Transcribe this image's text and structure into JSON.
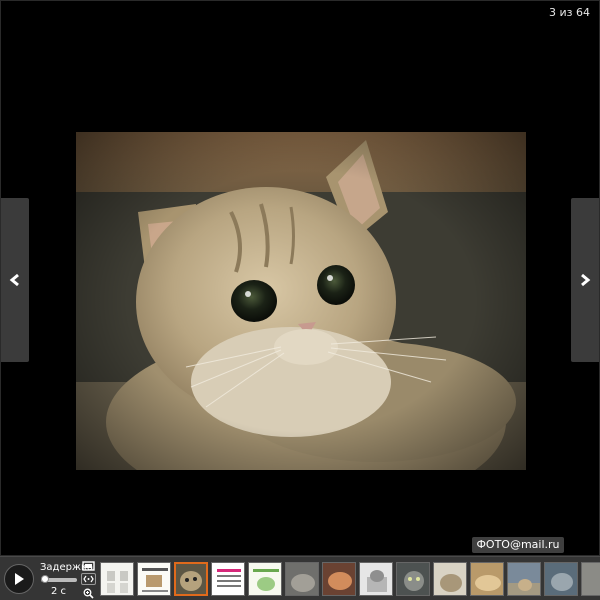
{
  "counter": {
    "text": "3 из 64"
  },
  "nav": {
    "prev_icon": "chevron-left-icon",
    "next_icon": "chevron-right-icon"
  },
  "photo": {
    "subject": "british-shorthair-cat-photo"
  },
  "watermark": {
    "text": "ФОТО@mail.ru"
  },
  "controls": {
    "play_icon": "play-icon",
    "delay_label": "Задержка",
    "delay_value": "2 с",
    "tools": [
      "fullscreen-icon",
      "embed-code-icon",
      "zoom-icon"
    ]
  },
  "thumbnails": {
    "active_index": 2,
    "items": [
      {
        "kind": "white-figures"
      },
      {
        "kind": "white-text-image"
      },
      {
        "kind": "cat",
        "active": true
      },
      {
        "kind": "pink-card"
      },
      {
        "kind": "green-card"
      },
      {
        "kind": "gray-cat"
      },
      {
        "kind": "orange-cat"
      },
      {
        "kind": "kitten-box"
      },
      {
        "kind": "gray-cat"
      },
      {
        "kind": "beige-cat"
      },
      {
        "kind": "sleeping-cat"
      },
      {
        "kind": "street-cat"
      },
      {
        "kind": "blue-cat"
      },
      {
        "kind": "more"
      }
    ]
  },
  "colors": {
    "accent": "#e06a1c",
    "panel": "#353535",
    "arrow_bg": "#3b3b3b"
  }
}
